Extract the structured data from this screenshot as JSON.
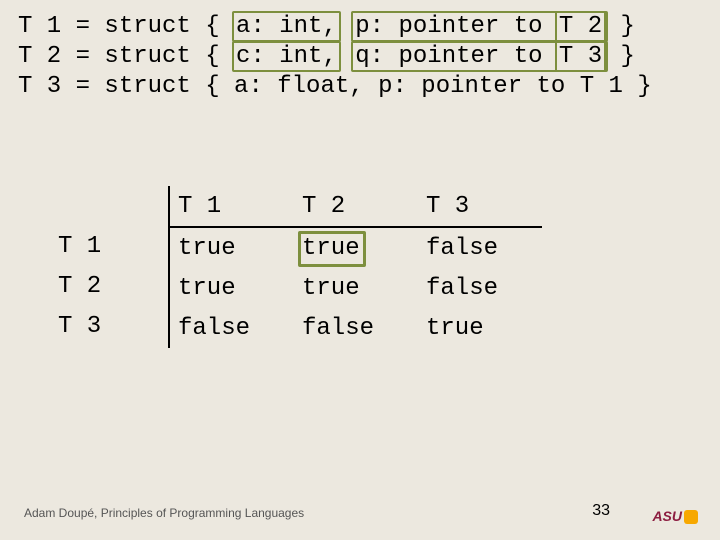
{
  "defs": [
    {
      "name": "T 1",
      "prefix": "T 1 = struct { ",
      "field1": "a: int,",
      "mid": " ",
      "field2": "p: pointer to ",
      "ptrTarget": "T 2",
      "suffix": " }",
      "hl1": true,
      "hl2": true,
      "hlT": true
    },
    {
      "name": "T 2",
      "prefix": "T 2 = struct { ",
      "field1": "c: int,",
      "mid": " ",
      "field2": "q: pointer to ",
      "ptrTarget": "T 3",
      "suffix": "  }",
      "hl1": true,
      "hl2": true,
      "hlT": true
    },
    {
      "name": "T 3",
      "prefix": "T 3 = struct { ",
      "field1": "a: float,",
      "mid": " ",
      "field2": "p: pointer to ",
      "ptrTarget": "T 1",
      "suffix": " }",
      "hl1": false,
      "hl2": false,
      "hlT": false
    }
  ],
  "table": {
    "cols": [
      "T 1",
      "T 2",
      "T 3"
    ],
    "rows": [
      "T 1",
      "T 2",
      "T 3"
    ],
    "data": [
      [
        {
          "v": "true",
          "hl": false
        },
        {
          "v": "true",
          "hl": true
        },
        {
          "v": "false",
          "hl": false
        }
      ],
      [
        {
          "v": "true",
          "hl": false
        },
        {
          "v": "true",
          "hl": false
        },
        {
          "v": "false",
          "hl": false
        }
      ],
      [
        {
          "v": "false",
          "hl": false
        },
        {
          "v": "false",
          "hl": false
        },
        {
          "v": "true",
          "hl": false
        }
      ]
    ]
  },
  "footer": "Adam Doupé, Principles of Programming Languages",
  "page": "33",
  "logo": "ASU"
}
